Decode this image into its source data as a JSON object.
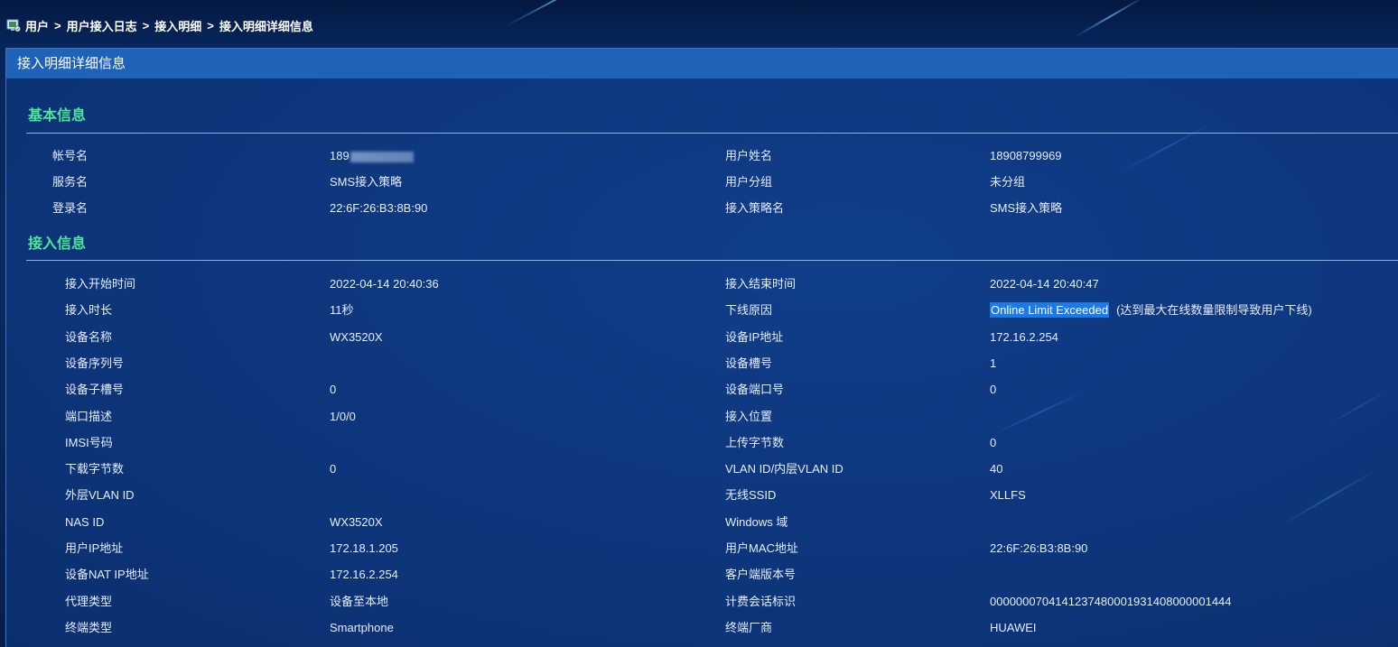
{
  "breadcrumb": {
    "items": [
      "用户",
      "用户接入日志",
      "接入明细",
      "接入明细详细信息"
    ],
    "separator": ">"
  },
  "panel": {
    "title": "接入明细详细信息"
  },
  "basic": {
    "title": "基本信息",
    "rows": [
      {
        "l1": "帐号名",
        "v1": "189",
        "l2": "用户姓名",
        "v2": "18908799969"
      },
      {
        "l1": "服务名",
        "v1": "SMS接入策略",
        "l2": "用户分组",
        "v2": "未分组"
      },
      {
        "l1": "登录名",
        "v1": "22:6F:26:B3:8B:90",
        "l2": "接入策略名",
        "v2": "SMS接入策略"
      }
    ]
  },
  "access": {
    "title": "接入信息",
    "rows": [
      {
        "l1": "接入开始时间",
        "v1": "2022-04-14 20:40:36",
        "l2": "接入结束时间",
        "v2": "2022-04-14 20:40:47"
      },
      {
        "l1": "接入时长",
        "v1": "11秒",
        "l2": "下线原因",
        "v2": "(达到最大在线数量限制导致用户下线)",
        "v2_highlight": "Online Limit Exceeded"
      },
      {
        "l1": "设备名称",
        "v1": "WX3520X",
        "l2": "设备IP地址",
        "v2": "172.16.2.254"
      },
      {
        "l1": "设备序列号",
        "v1": "",
        "l2": "设备槽号",
        "v2": "1"
      },
      {
        "l1": "设备子槽号",
        "v1": "0",
        "l2": "设备端口号",
        "v2": "0"
      },
      {
        "l1": "端口描述",
        "v1": "1/0/0",
        "l2": "接入位置",
        "v2": ""
      },
      {
        "l1": "IMSI号码",
        "v1": "",
        "l2": "上传字节数",
        "v2": "0"
      },
      {
        "l1": "下载字节数",
        "v1": "0",
        "l2": "VLAN ID/内层VLAN ID",
        "v2": "40"
      },
      {
        "l1": "外层VLAN ID",
        "v1": "",
        "l2": "无线SSID",
        "v2": "XLLFS"
      },
      {
        "l1": "NAS ID",
        "v1": "WX3520X",
        "l2": "Windows 域",
        "v2": ""
      },
      {
        "l1": "用户IP地址",
        "v1": "172.18.1.205",
        "l2": "用户MAC地址",
        "v2": "22:6F:26:B3:8B:90"
      },
      {
        "l1": "设备NAT IP地址",
        "v1": "172.16.2.254",
        "l2": "客户端版本号",
        "v2": ""
      },
      {
        "l1": "代理类型",
        "v1": "设备至本地",
        "l2": "计费会话标识",
        "v2": "00000007041412374800019314080000014​44"
      },
      {
        "l1": "终端类型",
        "v1": "Smartphone",
        "l2": "终端厂商",
        "v2": "HUAWEI"
      }
    ]
  },
  "icons": {
    "home": "home-icon"
  },
  "colors": {
    "section_title": "#4ee59a",
    "header_bar": "#1f63b8",
    "highlight": "#1a7ae6"
  }
}
